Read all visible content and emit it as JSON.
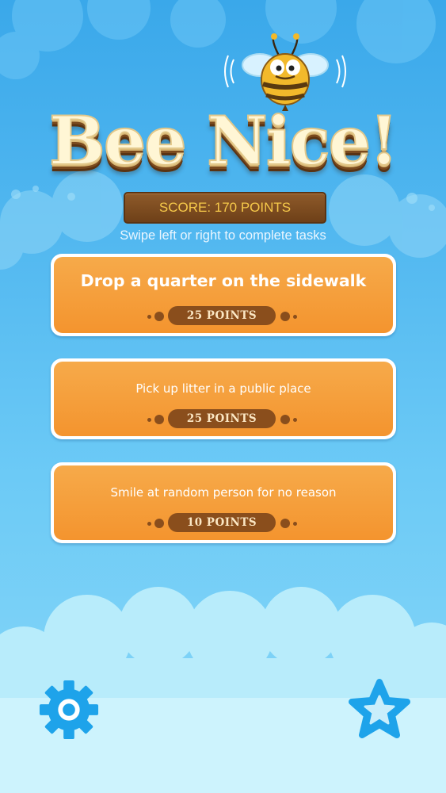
{
  "game": {
    "title": "Bee Nice!",
    "score_text": "SCORE: 170 POINTS",
    "instruction": "Swipe left or right to complete tasks"
  },
  "tasks": [
    {
      "text": "Drop a quarter on the sidewalk",
      "points": "25 POINTS"
    },
    {
      "text": "Pick up litter in a public place",
      "points": "25 POINTS"
    },
    {
      "text": "Smile at random person for no reason",
      "points": "10 POINTS"
    }
  ],
  "toolbar": {
    "settings_icon": "gear-icon",
    "favorites_icon": "star-icon"
  },
  "colors": {
    "sky": "#3aa8ea",
    "card_orange": "#f4942e",
    "points_pill": "#8a4e1c",
    "icon_blue": "#1ea3ea",
    "score_text": "#f6c94a"
  }
}
